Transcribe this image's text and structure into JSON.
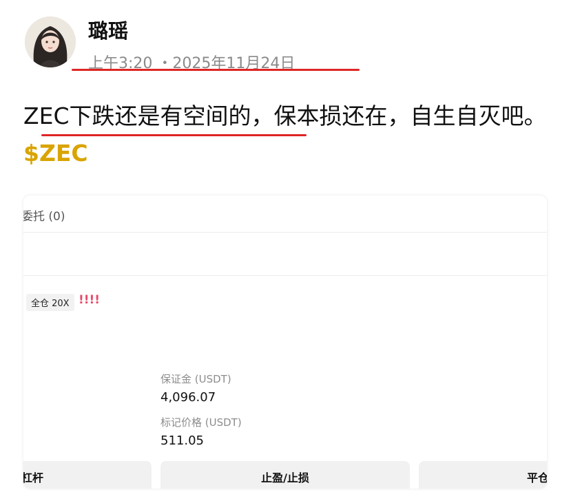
{
  "post": {
    "author": "璐瑶",
    "time": "上午3:20 ・2025年11月24日",
    "text_main": "ZEC下跌还是有空间的，保本损还在，自生自灭吧。",
    "ticker": "$ZEC",
    "underline_color": "#e02424",
    "ticker_color": "#d9a400"
  },
  "screenshot": {
    "orders_tab": "委托 (0)",
    "margin_badge": "全仓 20X",
    "warning_marks": "!!!!",
    "margin_label": "保证金 (USDT)",
    "margin_value": "4,096.07",
    "mark_price_label": "标记价格 (USDT)",
    "mark_price_value": "511.05",
    "buttons": {
      "leverage": "杠杆",
      "tp_sl": "止盈/止损",
      "close": "平仓"
    }
  }
}
